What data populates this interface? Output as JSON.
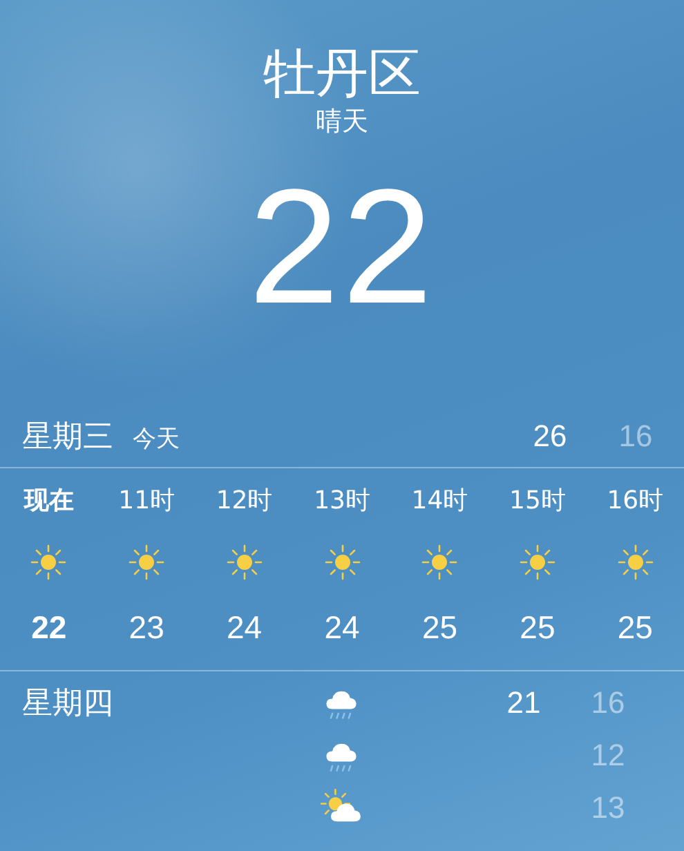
{
  "location": {
    "city": "牡丹区",
    "condition": "晴天",
    "temperature": "22"
  },
  "today": {
    "day": "星期三",
    "label": "今天",
    "high": "26",
    "low": "16"
  },
  "hourly": [
    {
      "time": "现在",
      "kind": "sun",
      "temp": "22",
      "now": true
    },
    {
      "time": "11时",
      "kind": "sun",
      "temp": "23",
      "now": false
    },
    {
      "time": "12时",
      "kind": "sun",
      "temp": "24",
      "now": false
    },
    {
      "time": "13时",
      "kind": "sun",
      "temp": "24",
      "now": false
    },
    {
      "time": "14时",
      "kind": "sun",
      "temp": "25",
      "now": false
    },
    {
      "time": "15时",
      "kind": "sun",
      "temp": "25",
      "now": false
    },
    {
      "time": "16时",
      "kind": "sun",
      "temp": "25",
      "now": false
    }
  ],
  "daily": [
    {
      "day": "星期四",
      "kind": "rain",
      "high": "21",
      "low": "16"
    },
    {
      "kind": "rain",
      "low": "12"
    },
    {
      "kind": "partly-cloudy",
      "low": "13"
    }
  ]
}
